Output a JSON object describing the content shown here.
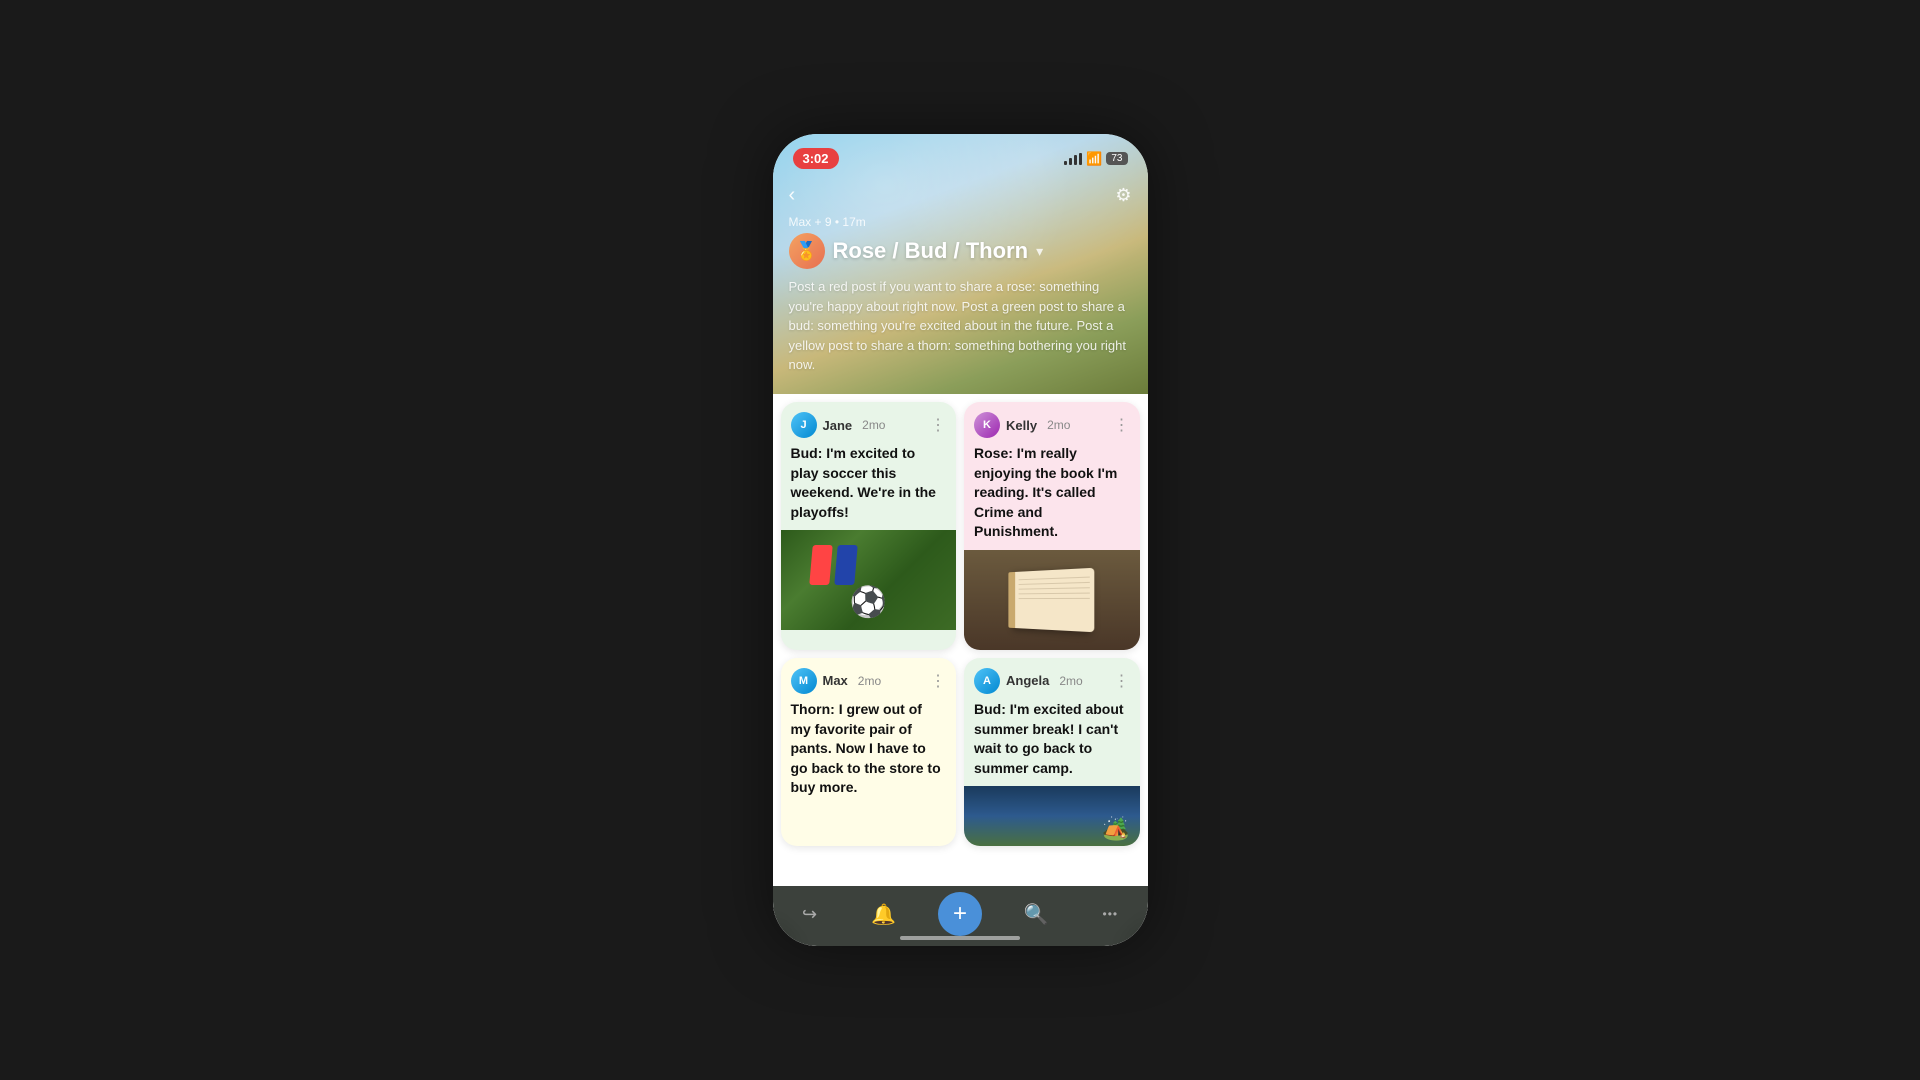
{
  "statusBar": {
    "time": "3:02",
    "battery": "73"
  },
  "header": {
    "meta": "Max + 9 • 17m",
    "title": "Rose / Bud / Thorn",
    "description": "Post a red post if you want to share a rose: something you're happy about right now. Post a green post to share a bud: something you're excited about in the future. Post a yellow post to share a thorn: something bothering you right now.",
    "avatar_emoji": "🏅"
  },
  "posts": [
    {
      "id": "post-jane",
      "user": "Jane",
      "time": "2mo",
      "type": "green",
      "text": "Bud: I'm excited to play soccer this weekend. We're in the playoffs!",
      "has_image": true,
      "image_type": "soccer"
    },
    {
      "id": "post-kelly",
      "user": "Kelly",
      "time": "2mo",
      "type": "pink",
      "text": "Rose: I'm really enjoying the book I'm reading. It's called Crime and Punishment.",
      "has_image": true,
      "image_type": "book"
    },
    {
      "id": "post-max",
      "user": "Max",
      "time": "2mo",
      "type": "yellow",
      "text": "Thorn: I grew out of my favorite pair of pants. Now I have to go back to the store to buy more.",
      "has_image": false
    },
    {
      "id": "post-angela",
      "user": "Angela",
      "time": "2mo",
      "type": "green",
      "text": "Bud: I'm excited about summer break! I can't wait to go back to summer camp.",
      "has_image": true,
      "image_type": "camp"
    }
  ],
  "nav": {
    "share_label": "↪",
    "bell_label": "🔔",
    "plus_label": "+",
    "search_label": "🔍",
    "more_label": "•••"
  }
}
